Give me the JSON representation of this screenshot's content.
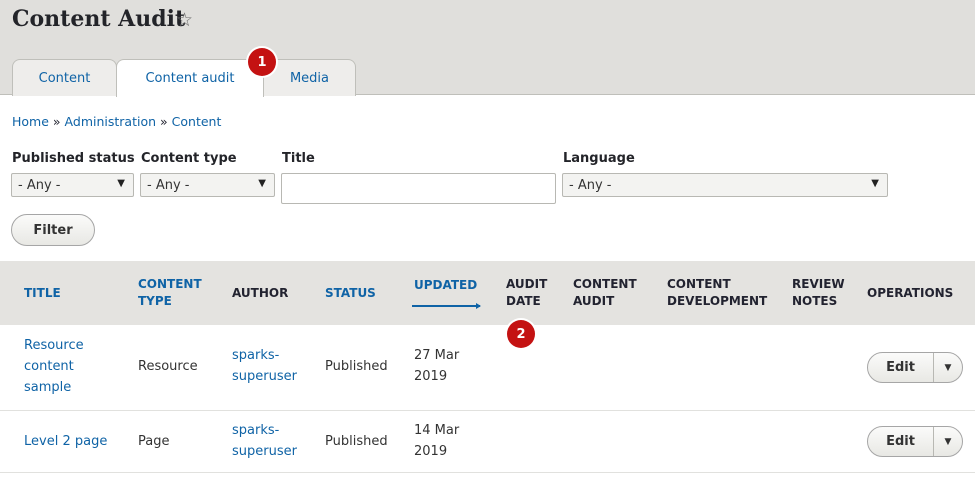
{
  "page": {
    "title": "Content Audit",
    "star_icon": "☆"
  },
  "tabs": [
    {
      "label": "Content"
    },
    {
      "label": "Content audit"
    },
    {
      "label": "Media"
    }
  ],
  "badges": [
    "1",
    "2"
  ],
  "breadcrumb": {
    "home": "Home",
    "admin": "Administration",
    "content": "Content",
    "sep": "»"
  },
  "filters": {
    "published_status": {
      "label": "Published status",
      "value": "- Any -"
    },
    "content_type": {
      "label": "Content type",
      "value": "- Any -"
    },
    "title": {
      "label": "Title",
      "value": ""
    },
    "language": {
      "label": "Language",
      "value": "- Any -"
    },
    "filter_button": "Filter"
  },
  "table": {
    "headers": {
      "title": "TITLE",
      "content_type": [
        "CONTENT",
        "TYPE"
      ],
      "author": "AUTHOR",
      "status": "STATUS",
      "updated": "UPDATED",
      "audit_date": [
        "AUDIT",
        "DATE"
      ],
      "content_audit": [
        "CONTENT",
        "AUDIT"
      ],
      "content_development": [
        "CONTENT",
        "DEVELOPMENT"
      ],
      "review_notes": [
        "REVIEW",
        "NOTES"
      ],
      "operations": "OPERATIONS"
    },
    "rows": [
      {
        "title": [
          "Resource",
          "content",
          "sample"
        ],
        "content_type": "Resource",
        "author": [
          "sparks-",
          "superuser"
        ],
        "status": "Published",
        "updated": [
          "27 Mar",
          "2019"
        ],
        "edit": "Edit"
      },
      {
        "title": [
          "Level 2 page"
        ],
        "content_type": "Page",
        "author": [
          "sparks-",
          "superuser"
        ],
        "status": "Published",
        "updated": [
          "14 Mar",
          "2019"
        ],
        "edit": "Edit"
      }
    ]
  },
  "colors": {
    "link": "#0f63a6",
    "badge": "#c41212",
    "header_bg": "#e0dfdc"
  }
}
